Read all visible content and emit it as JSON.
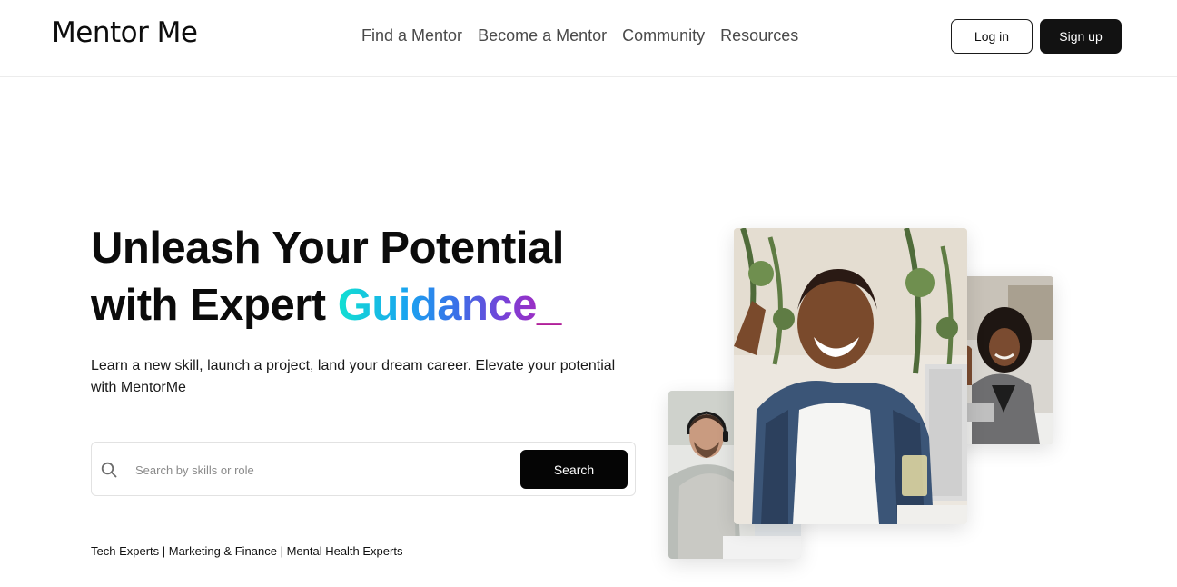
{
  "header": {
    "logo": "Mentor Me",
    "nav": [
      "Find a Mentor",
      "Become a Mentor",
      "Community",
      "Resources"
    ],
    "login_label": "Log in",
    "signup_label": "Sign up"
  },
  "hero": {
    "headline_line1": "Unleash Your Potential",
    "headline_line2_prefix": "with Expert ",
    "headline_highlight": "Guidance",
    "headline_cursor": "_",
    "subtext": "Learn a new skill, launch a project, land your dream career. Elevate your potential with MentorMe",
    "search": {
      "placeholder": "Search by skills or role",
      "value": "",
      "button_label": "Search",
      "icon": "search-icon"
    },
    "categories": "Tech Experts | Marketing & Finance | Mental Health Experts"
  },
  "colors": {
    "primary": "#121212",
    "gradient": [
      "#12e0d2",
      "#1aa3f0",
      "#3b6fe8",
      "#7a3fd6",
      "#9c2fc4"
    ],
    "cursor": "#b0209a"
  },
  "images": {
    "main": "smiling-woman-photo",
    "small": "man-with-headset-photo",
    "back": "woman-at-laptop-photo"
  }
}
